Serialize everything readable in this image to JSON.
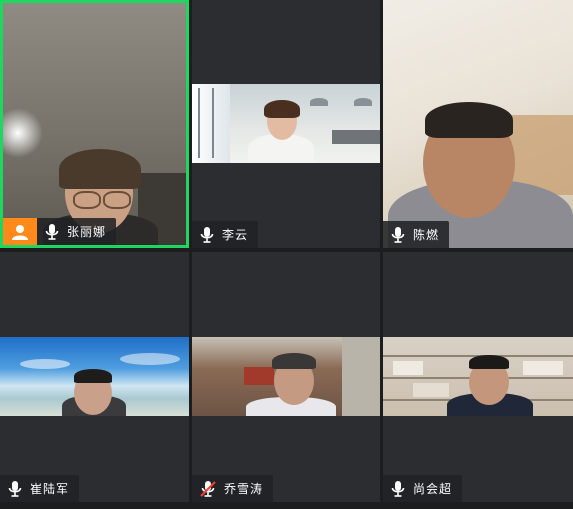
{
  "participants": [
    {
      "name": "张丽娜",
      "mic": "on",
      "host": true,
      "active": true
    },
    {
      "name": "李云",
      "mic": "on",
      "host": false,
      "active": false
    },
    {
      "name": "陈燃",
      "mic": "on",
      "host": false,
      "active": false
    },
    {
      "name": "崔陆军",
      "mic": "on",
      "host": false,
      "active": false
    },
    {
      "name": "乔雪涛",
      "mic": "muted",
      "host": false,
      "active": false
    },
    {
      "name": "尚会超",
      "mic": "on",
      "host": false,
      "active": false
    }
  ],
  "colors": {
    "active_border": "#1ed760",
    "host_badge": "#ff8a1a",
    "muted_mic": "#ff3b30",
    "tile_bg": "#2b2d30"
  },
  "icons": {
    "host": "person-icon",
    "mic": "microphone-icon",
    "mic_muted": "microphone-muted-icon"
  }
}
